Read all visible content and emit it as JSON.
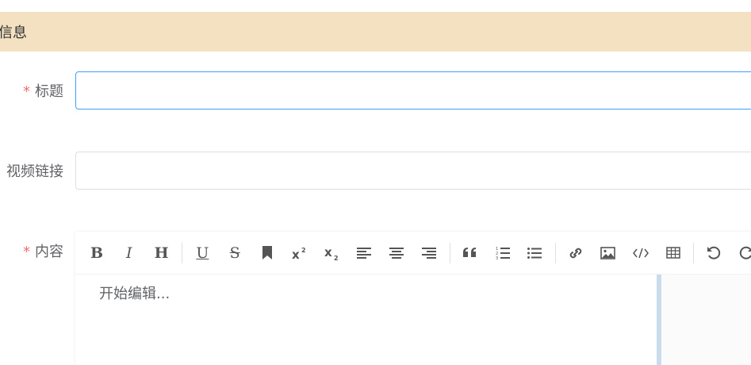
{
  "section": {
    "title": "信息"
  },
  "form": {
    "title_field": {
      "label": "标题",
      "required": true,
      "value": "",
      "placeholder": ""
    },
    "video_field": {
      "label": "视频链接",
      "required": false,
      "value": "",
      "placeholder": ""
    },
    "content_field": {
      "label": "内容",
      "required": true,
      "placeholder": "开始编辑..."
    }
  },
  "required_mark": "*",
  "toolbar": {
    "bold": "B",
    "italic": "I",
    "header": "H",
    "underline": "U",
    "strikethrough": "S",
    "icons": [
      "bold-icon",
      "italic-icon",
      "header-icon",
      "underline-icon",
      "strikethrough-icon",
      "bookmark-icon",
      "superscript-icon",
      "subscript-icon",
      "align-left-icon",
      "align-center-icon",
      "align-right-icon",
      "quote-icon",
      "ordered-list-icon",
      "unordered-list-icon",
      "link-icon",
      "image-icon",
      "code-icon",
      "table-icon",
      "undo-icon",
      "redo-icon"
    ]
  },
  "colors": {
    "header_bg": "#f3e1c1",
    "required": "#f56c6c",
    "focus_border": "#409eff",
    "divider": "#c9dceb"
  }
}
